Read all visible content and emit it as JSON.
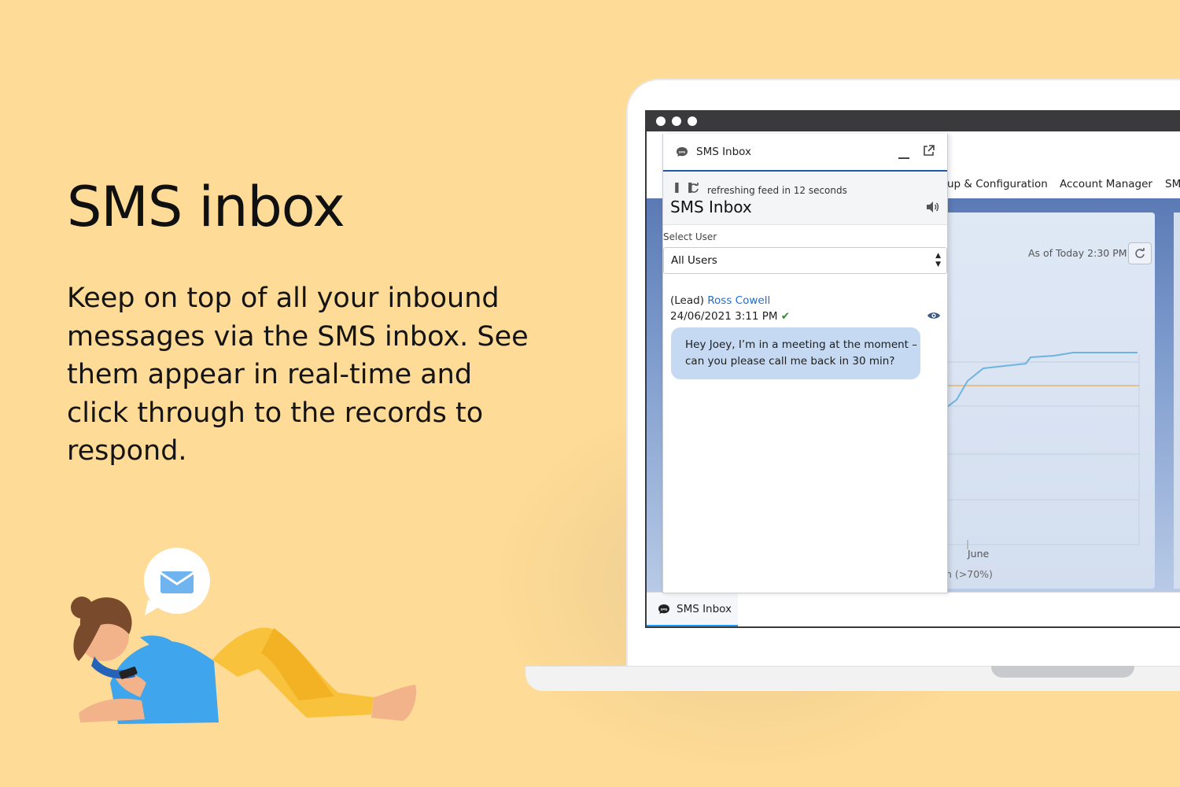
{
  "hero": {
    "title": "SMS inbox",
    "description": "Keep on top of all your inbound messages via the SMS inbox. See them appear in real-time and click through to the records to respond."
  },
  "app_nav": {
    "items": [
      "up & Configuration",
      "Account Manager",
      "SM"
    ]
  },
  "dashboard": {
    "as_of": "As of Today 2:30 PM",
    "x_axis_label": "June",
    "legend_fragment": "n (>70%)"
  },
  "sms_panel": {
    "header_title": "SMS Inbox",
    "refresh_text": "refreshing feed in 12 seconds",
    "title": "SMS Inbox",
    "select_label": "Select User",
    "select_value": "All Users",
    "message": {
      "record_type": "(Lead)",
      "contact_name": "Ross Cowell",
      "timestamp": "24/06/2021 3:11 PM",
      "body": "Hey Joey, I’m in a meeting at the moment – can you please call me back in 30 min?"
    }
  },
  "footer": {
    "tab_label": "SMS Inbox",
    "tab_icon_text": "SMS"
  },
  "colors": {
    "background": "#fedb96",
    "accent": "#1b96ff",
    "bubble": "#c5daf2",
    "link": "#1b6fd0"
  }
}
